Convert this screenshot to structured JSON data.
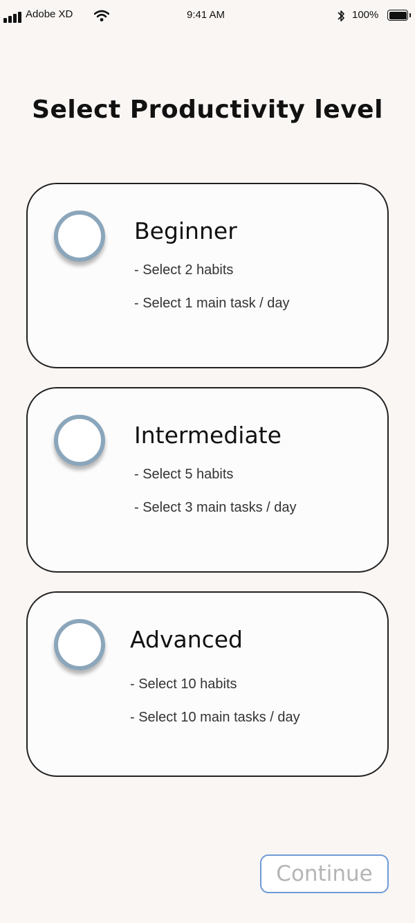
{
  "status_bar": {
    "carrier": "Adobe XD",
    "time": "9:41 AM",
    "battery": "100%"
  },
  "title": "Select Productivity level",
  "levels": [
    {
      "name": "Beginner",
      "details": [
        "- Select 2 habits",
        "- Select 1 main task / day"
      ]
    },
    {
      "name": "Intermediate",
      "details": [
        "- Select 5 habits",
        "- Select 3 main tasks / day"
      ]
    },
    {
      "name": "Advanced",
      "details": [
        "- Select 10 habits",
        "- Select 10 main tasks / day"
      ]
    }
  ],
  "continue_label": "Continue",
  "icons": {
    "signal": "signal-bars-icon",
    "wifi": "wifi-icon",
    "bluetooth": "bluetooth-icon",
    "battery": "battery-icon",
    "radio": "radio-unselected-icon"
  },
  "colors": {
    "background": "#f9f6f4",
    "radio_border": "#8ba6bb",
    "continue_border": "#6f9ad6",
    "continue_text": "#b5b5b5"
  }
}
